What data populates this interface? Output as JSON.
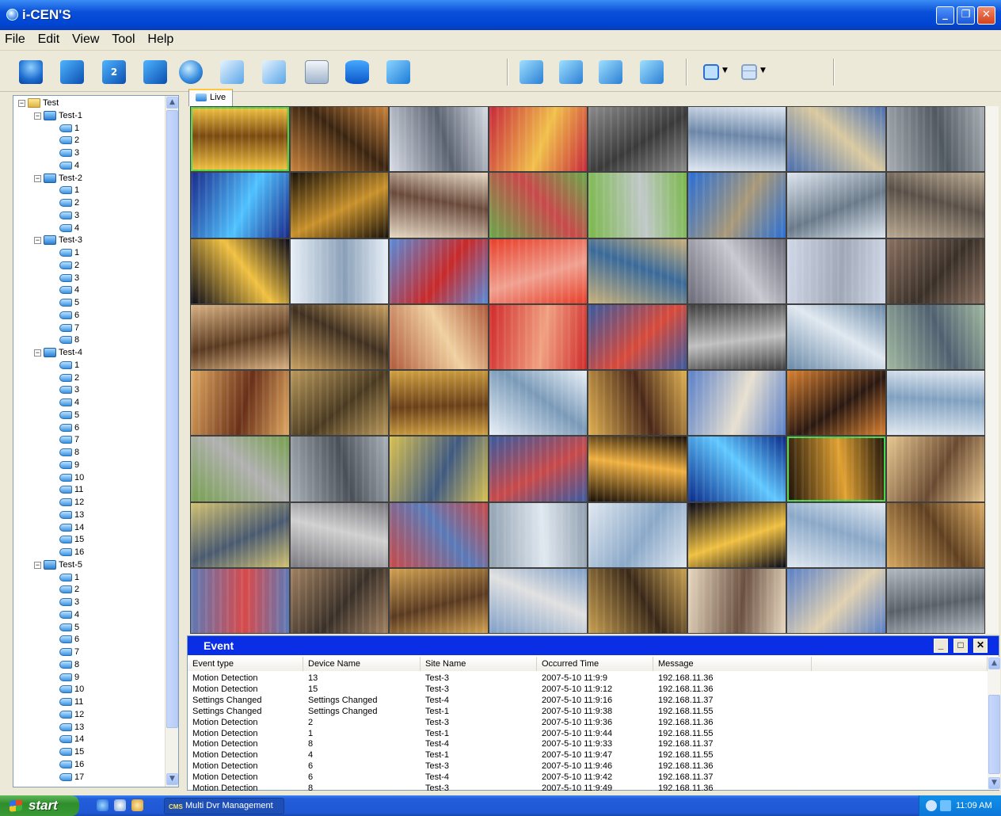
{
  "window": {
    "title": "i-CEN'S"
  },
  "menu": [
    "File",
    "Edit",
    "View",
    "Tool",
    "Help"
  ],
  "toolbar": {
    "icons": [
      "users-icon",
      "monitor-icon",
      "monitor-2-icon",
      "monitor-play-icon",
      "globe-network-icon",
      "camera-ptz-icon",
      "camera-schedule-icon",
      "first-aid-icon",
      "database-icon",
      "monitor-settings-icon",
      "layout-1-icon",
      "layout-2-icon",
      "layout-3-icon",
      "layout-4-icon",
      "split-view-icon",
      "quad-view-icon"
    ]
  },
  "tree": {
    "root": "Test",
    "groups": [
      {
        "name": "Test-1",
        "channels": [
          "1",
          "2",
          "3",
          "4"
        ]
      },
      {
        "name": "Test-2",
        "channels": [
          "1",
          "2",
          "3",
          "4"
        ]
      },
      {
        "name": "Test-3",
        "channels": [
          "1",
          "2",
          "3",
          "4",
          "5",
          "6",
          "7",
          "8"
        ]
      },
      {
        "name": "Test-4",
        "channels": [
          "1",
          "2",
          "3",
          "4",
          "5",
          "6",
          "7",
          "8",
          "9",
          "10",
          "11",
          "12",
          "13",
          "14",
          "15",
          "16"
        ]
      },
      {
        "name": "Test-5",
        "channels": [
          "1",
          "2",
          "3",
          "4",
          "5",
          "6",
          "7",
          "8",
          "9",
          "10",
          "11",
          "12",
          "13",
          "14",
          "15",
          "16",
          "17"
        ]
      }
    ]
  },
  "live_tab": {
    "label": "Live"
  },
  "event_panel": {
    "title": "Event",
    "columns": [
      "Event type",
      "Device Name",
      "Site Name",
      "Occurred Time",
      "Message"
    ],
    "rows": [
      [
        "Motion Detection",
        "13",
        "Test-3",
        "2007-5-10 11:9:9",
        "192.168.11.36"
      ],
      [
        "Motion Detection",
        "15",
        "Test-3",
        "2007-5-10 11:9:12",
        "192.168.11.36"
      ],
      [
        "Settings Changed",
        "Settings Changed",
        "Test-4",
        "2007-5-10 11:9:16",
        "192.168.11.37"
      ],
      [
        "Settings Changed",
        "Settings Changed",
        "Test-1",
        "2007-5-10 11:9:38",
        "192.168.11.55"
      ],
      [
        "Motion Detection",
        "2",
        "Test-3",
        "2007-5-10 11:9:36",
        "192.168.11.36"
      ],
      [
        "Motion Detection",
        "1",
        "Test-1",
        "2007-5-10 11:9:44",
        "192.168.11.55"
      ],
      [
        "Motion Detection",
        "8",
        "Test-4",
        "2007-5-10 11:9:33",
        "192.168.11.37"
      ],
      [
        "Motion Detection",
        "4",
        "Test-1",
        "2007-5-10 11:9:47",
        "192.168.11.55"
      ],
      [
        "Motion Detection",
        "6",
        "Test-3",
        "2007-5-10 11:9:46",
        "192.168.11.36"
      ],
      [
        "Motion Detection",
        "6",
        "Test-4",
        "2007-5-10 11:9:42",
        "192.168.11.37"
      ],
      [
        "Motion Detection",
        "8",
        "Test-3",
        "2007-5-10 11:9:49",
        "192.168.11.36"
      ]
    ]
  },
  "taskbar": {
    "start": "start",
    "item": "Multi Dvr Management",
    "item_badge": "CMS",
    "clock": "11:09 AM"
  }
}
